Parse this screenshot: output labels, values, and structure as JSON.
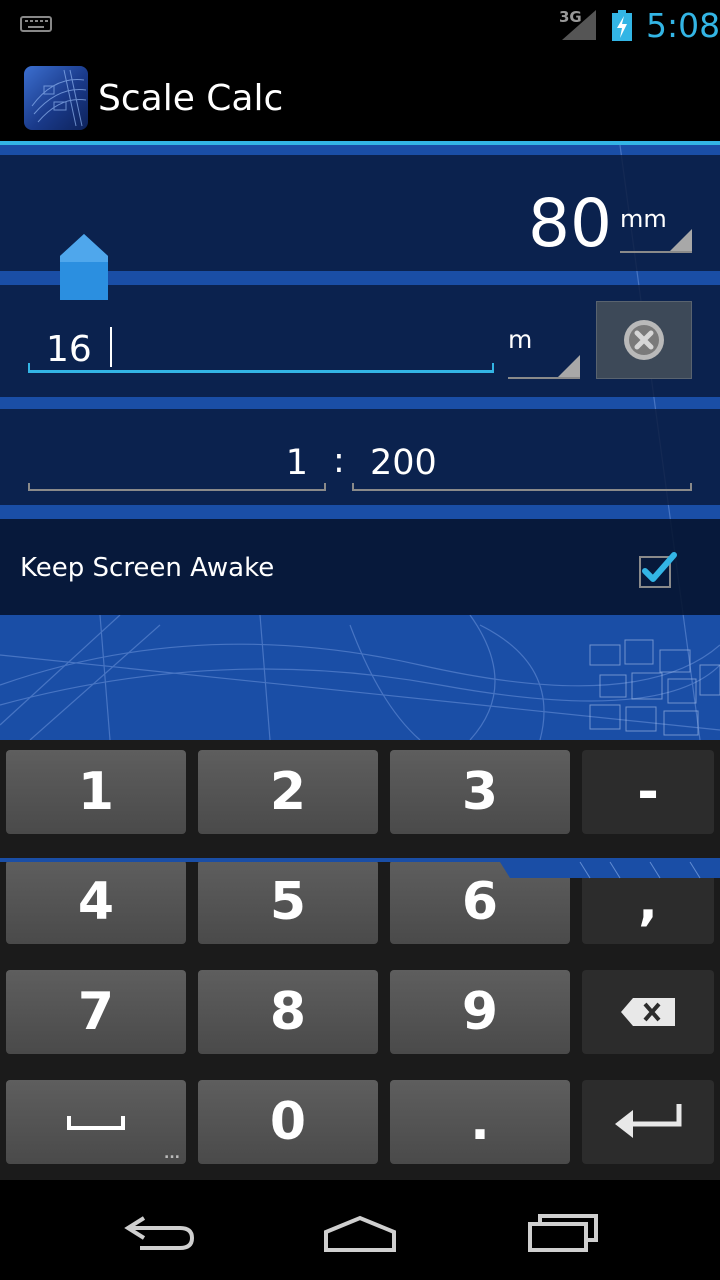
{
  "status_bar": {
    "network_type": "3G",
    "time": "5:08",
    "icons": [
      "keyboard-icon",
      "signal-icon",
      "battery-charging-icon"
    ]
  },
  "action_bar": {
    "title": "Scale Calc",
    "icon": "blueprint-app-icon"
  },
  "drawing_measure": {
    "value": "80",
    "unit": "mm"
  },
  "real_measure": {
    "value": "16",
    "unit": "m",
    "clear_icon": "clear-icon"
  },
  "scale": {
    "left": "1",
    "separator": ":",
    "right": "200"
  },
  "settings": {
    "keep_awake_label": "Keep Screen Awake",
    "keep_awake_checked": true
  },
  "keyboard": {
    "rows": [
      [
        "1",
        "2",
        "3",
        "-"
      ],
      [
        "4",
        "5",
        "6",
        ","
      ],
      [
        "7",
        "8",
        "9",
        "backspace"
      ],
      [
        "space",
        "0",
        ".",
        "enter"
      ]
    ],
    "key_1": "1",
    "key_2": "2",
    "key_3": "3",
    "key_minus": "-",
    "key_4": "4",
    "key_5": "5",
    "key_6": "6",
    "key_comma": ",",
    "key_7": "7",
    "key_8": "8",
    "key_9": "9",
    "key_0": "0",
    "key_dot": ".",
    "space_hint": "..."
  },
  "nav_bar": {
    "icons": [
      "back-icon",
      "home-icon",
      "recent-apps-icon"
    ]
  },
  "colors": {
    "accent": "#33b5e5",
    "blueprint": "#1a4ea6",
    "panel": "#08193a"
  }
}
